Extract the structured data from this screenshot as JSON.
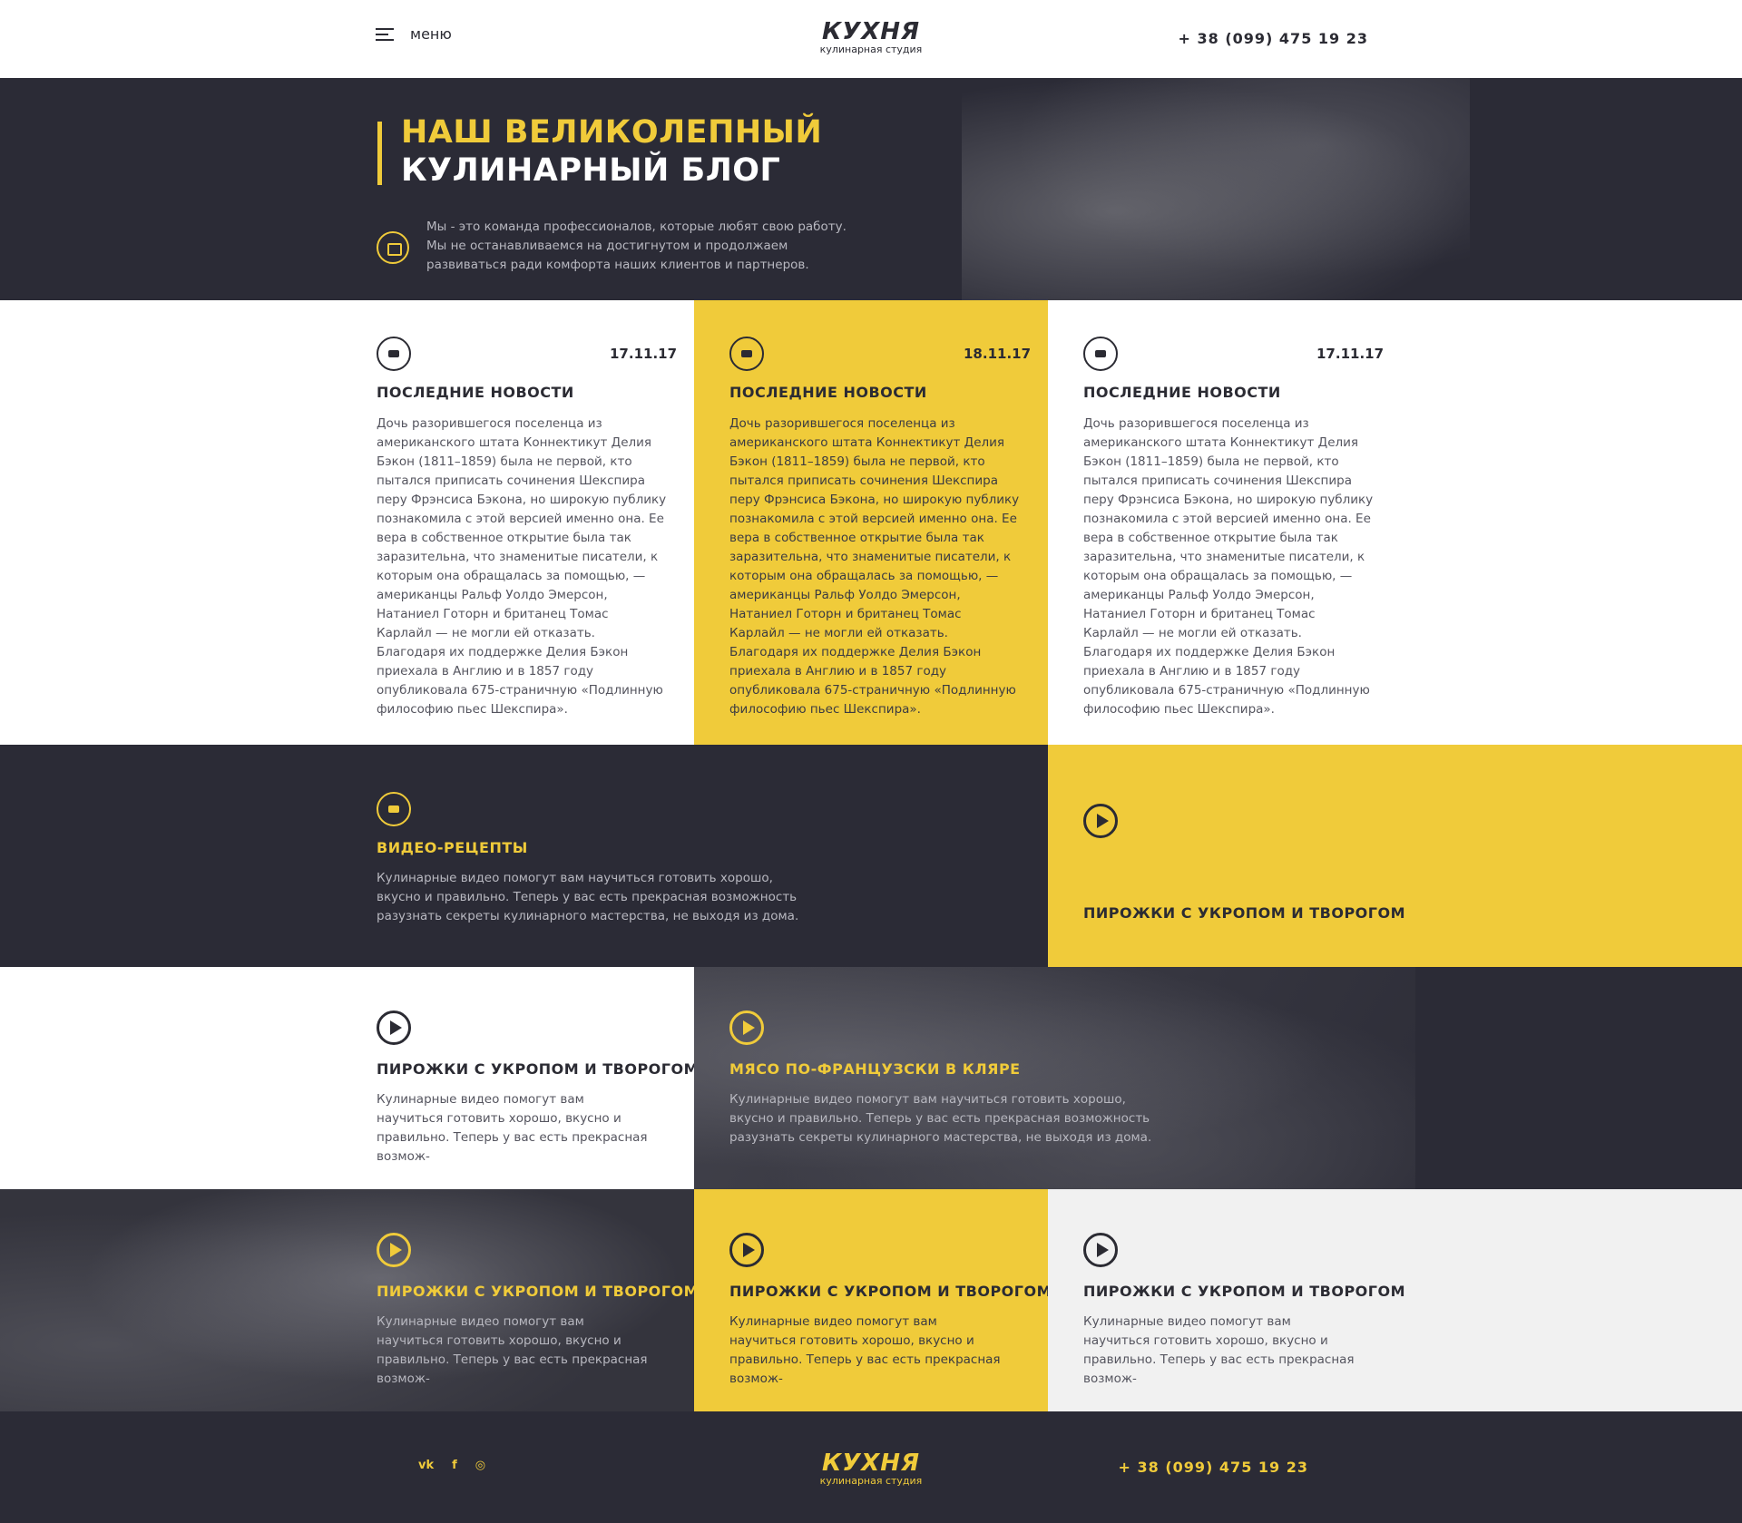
{
  "header": {
    "menu_label": "меню",
    "logo_word": "КУХНЯ",
    "logo_sub": "кулинарная студия",
    "phone": "+ 38 (099) 475 19 23"
  },
  "hero": {
    "title_line1": "НАШ ВЕЛИКОЛЕПНЫЙ",
    "title_line2": "КУЛИНАРНЫЙ БЛОГ",
    "text": "Мы - это команда профессионалов, которые любят свою работу. Мы не останавливаемся на достигнутом и продолжаем развиваться ради комфорта наших клиентов и партнеров."
  },
  "news": [
    {
      "date": "17.11.17",
      "title": "ПОСЛЕДНИЕ НОВОСТИ",
      "text": "Дочь разорившегося поселенца из американского штата Коннектикут Делия Бэкон (1811–1859) была не первой, кто пытался приписать сочинения Шекспира перу Фрэнсиса Бэкона, но широкую публику познакомила с этой версией именно она. Ее вера в собственное открытие была так заразительна, что знаменитые писатели, к которым она обращалась за помощью, — американцы Ральф Уолдо Эмерсон, Натаниел Готорн и британец Томас Карлайл — не могли ей отказать. Благодаря их поддержке Делия Бэкон приехала в Англию и в 1857 году опубликовала 675-страничную «Подлинную философию пьес Шекспира»."
    },
    {
      "date": "18.11.17",
      "title": "ПОСЛЕДНИЕ НОВОСТИ",
      "text": "Дочь разорившегося поселенца из американского штата Коннектикут Делия Бэкон (1811–1859) была не первой, кто пытался приписать сочинения Шекспира перу Фрэнсиса Бэкона, но широкую публику познакомила с этой версией именно она. Ее вера в собственное открытие была так заразительна, что знаменитые писатели, к которым она обращалась за помощью, — американцы Ральф Уолдо Эмерсон, Натаниел Готорн и британец Томас Карлайл — не могли ей отказать. Благодаря их поддержке Делия Бэкон приехала в Англию и в 1857 году опубликовала 675-страничную «Подлинную философию пьес Шекспира»."
    },
    {
      "date": "17.11.17",
      "title": "ПОСЛЕДНИЕ НОВОСТИ",
      "text": "Дочь разорившегося поселенца из американского штата Коннектикут Делия Бэкон (1811–1859) была не первой, кто пытался приписать сочинения Шекспира перу Фрэнсиса Бэкона, но широкую публику познакомила с этой версией именно она. Ее вера в собственное открытие была так заразительна, что знаменитые писатели, к которым она обращалась за помощью, — американцы Ральф Уолдо Эмерсон, Натаниел Готорн и британец Томас Карлайл — не могли ей отказать. Благодаря их поддержке Делия Бэкон приехала в Англию и в 1857 году опубликовала 675-страничную «Подлинную философию пьес Шекспира»."
    }
  ],
  "video_recipes": {
    "title": "ВИДЕО-РЕЦЕПТЫ",
    "text": "Кулинарные видео помогут вам научиться готовить хорошо, вкусно и правильно. Теперь у вас есть прекрасная возможность разузнать секреты кулинарного мастерства, не выходя из дома."
  },
  "cards": [
    {
      "title": "ПИРОЖКИ С УКРОПОМ И ТВОРОГОМ",
      "text": ""
    },
    {
      "title": "ПИРОЖКИ С УКРОПОМ И ТВОРОГОМ",
      "text": "Кулинарные видео помогут вам научиться готовить хорошо, вкусно и правильно. Теперь у вас есть прекрасная возмож-"
    },
    {
      "title": "МЯСО ПО-ФРАНЦУЗСКИ В КЛЯРЕ",
      "text": "Кулинарные видео помогут вам научиться готовить хорошо, вкусно и правильно. Теперь у вас есть прекрасная возможность разузнать секреты кулинарного мастерства, не выходя из дома."
    },
    {
      "title": "ПИРОЖКИ С УКРОПОМ И ТВОРОГОМ",
      "text": "Кулинарные видео помогут вам научиться готовить хорошо, вкусно и правильно. Теперь у вас есть прекрасная возмож-"
    },
    {
      "title": "ПИРОЖКИ С УКРОПОМ И ТВОРОГОМ",
      "text": "Кулинарные видео помогут вам научиться готовить хорошо, вкусно и правильно. Теперь у вас есть прекрасная возмож-"
    },
    {
      "title": "ПИРОЖКИ С УКРОПОМ И ТВОРОГОМ",
      "text": "Кулинарные видео помогут вам научиться готовить хорошо, вкусно и правильно. Теперь у вас есть прекрасная возмож-"
    }
  ],
  "footer": {
    "socials": [
      "vk",
      "f",
      "◎"
    ],
    "social_icons": [
      "vk-icon",
      "facebook-icon",
      "instagram-icon"
    ],
    "logo_word": "КУХНЯ",
    "logo_sub": "кулинарная студия",
    "phone": "+ 38 (099) 475 19 23"
  },
  "colors": {
    "accent": "#f0cb3a",
    "dark": "#2b2b36",
    "light_gray": "#f1f1f1"
  }
}
